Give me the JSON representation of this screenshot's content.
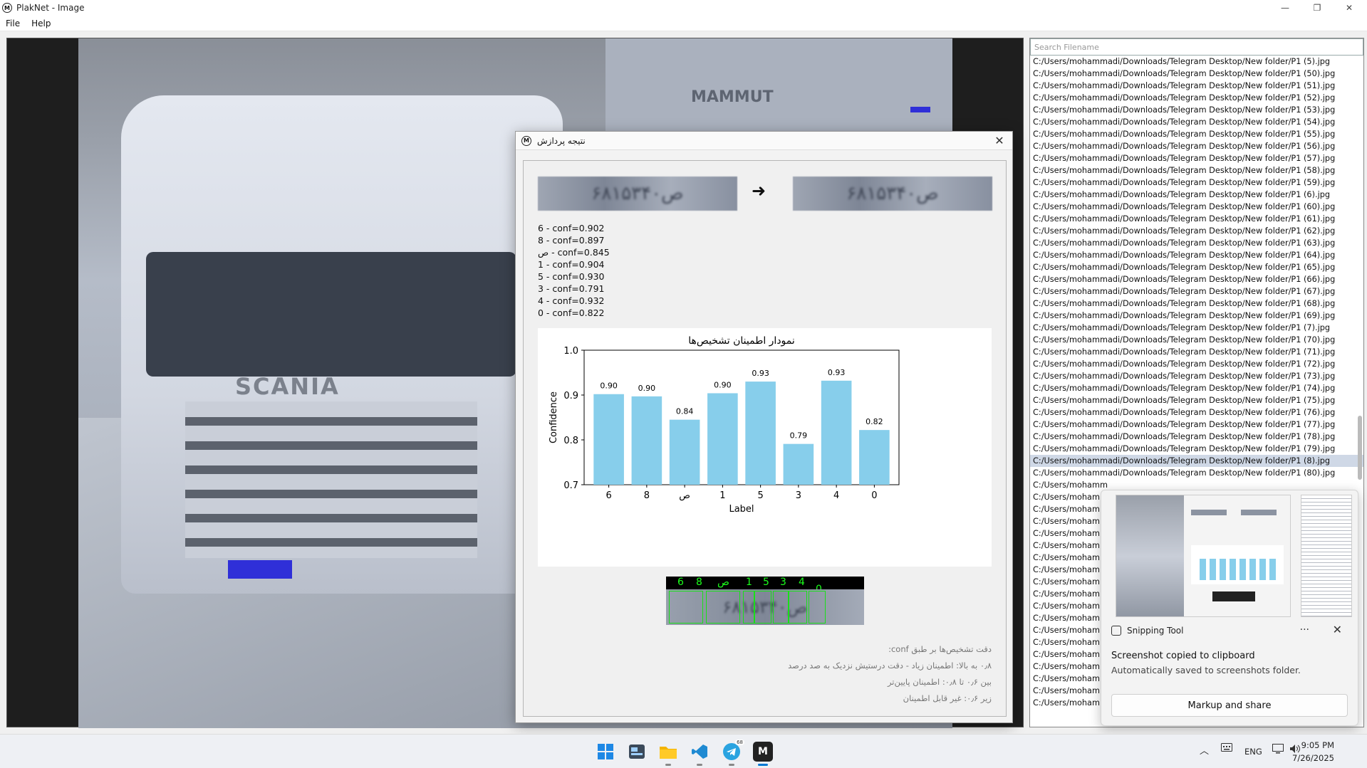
{
  "window": {
    "title": "PlakNet - Image",
    "logo_letter": "M",
    "minimize": "—",
    "maximize": "❐",
    "close": "✕"
  },
  "menu": [
    "File",
    "Help"
  ],
  "filelist": {
    "search_placeholder": "Search Filename",
    "items": [
      "C:/Users/mohammadi/Downloads/Telegram Desktop/New folder/P1 (5).jpg",
      "C:/Users/mohammadi/Downloads/Telegram Desktop/New folder/P1 (50).jpg",
      "C:/Users/mohammadi/Downloads/Telegram Desktop/New folder/P1 (51).jpg",
      "C:/Users/mohammadi/Downloads/Telegram Desktop/New folder/P1 (52).jpg",
      "C:/Users/mohammadi/Downloads/Telegram Desktop/New folder/P1 (53).jpg",
      "C:/Users/mohammadi/Downloads/Telegram Desktop/New folder/P1 (54).jpg",
      "C:/Users/mohammadi/Downloads/Telegram Desktop/New folder/P1 (55).jpg",
      "C:/Users/mohammadi/Downloads/Telegram Desktop/New folder/P1 (56).jpg",
      "C:/Users/mohammadi/Downloads/Telegram Desktop/New folder/P1 (57).jpg",
      "C:/Users/mohammadi/Downloads/Telegram Desktop/New folder/P1 (58).jpg",
      "C:/Users/mohammadi/Downloads/Telegram Desktop/New folder/P1 (59).jpg",
      "C:/Users/mohammadi/Downloads/Telegram Desktop/New folder/P1 (6).jpg",
      "C:/Users/mohammadi/Downloads/Telegram Desktop/New folder/P1 (60).jpg",
      "C:/Users/mohammadi/Downloads/Telegram Desktop/New folder/P1 (61).jpg",
      "C:/Users/mohammadi/Downloads/Telegram Desktop/New folder/P1 (62).jpg",
      "C:/Users/mohammadi/Downloads/Telegram Desktop/New folder/P1 (63).jpg",
      "C:/Users/mohammadi/Downloads/Telegram Desktop/New folder/P1 (64).jpg",
      "C:/Users/mohammadi/Downloads/Telegram Desktop/New folder/P1 (65).jpg",
      "C:/Users/mohammadi/Downloads/Telegram Desktop/New folder/P1 (66).jpg",
      "C:/Users/mohammadi/Downloads/Telegram Desktop/New folder/P1 (67).jpg",
      "C:/Users/mohammadi/Downloads/Telegram Desktop/New folder/P1 (68).jpg",
      "C:/Users/mohammadi/Downloads/Telegram Desktop/New folder/P1 (69).jpg",
      "C:/Users/mohammadi/Downloads/Telegram Desktop/New folder/P1 (7).jpg",
      "C:/Users/mohammadi/Downloads/Telegram Desktop/New folder/P1 (70).jpg",
      "C:/Users/mohammadi/Downloads/Telegram Desktop/New folder/P1 (71).jpg",
      "C:/Users/mohammadi/Downloads/Telegram Desktop/New folder/P1 (72).jpg",
      "C:/Users/mohammadi/Downloads/Telegram Desktop/New folder/P1 (73).jpg",
      "C:/Users/mohammadi/Downloads/Telegram Desktop/New folder/P1 (74).jpg",
      "C:/Users/mohammadi/Downloads/Telegram Desktop/New folder/P1 (75).jpg",
      "C:/Users/mohammadi/Downloads/Telegram Desktop/New folder/P1 (76).jpg",
      "C:/Users/mohammadi/Downloads/Telegram Desktop/New folder/P1 (77).jpg",
      "C:/Users/mohammadi/Downloads/Telegram Desktop/New folder/P1 (78).jpg",
      "C:/Users/mohammadi/Downloads/Telegram Desktop/New folder/P1 (79).jpg",
      "C:/Users/mohammadi/Downloads/Telegram Desktop/New folder/P1 (8).jpg",
      "C:/Users/mohammadi/Downloads/Telegram Desktop/New folder/P1 (80).jpg",
      "C:/Users/mohamm",
      "C:/Users/mohamm",
      "C:/Users/mohamm",
      "C:/Users/mohamm",
      "C:/Users/mohamm",
      "C:/Users/mohamm",
      "C:/Users/mohamm",
      "C:/Users/mohamm",
      "C:/Users/mohamm",
      "C:/Users/mohamm",
      "C:/Users/mohamm",
      "C:/Users/mohamm",
      "C:/Users/mohamm",
      "C:/Users/mohamm",
      "C:/Users/mohamm",
      "C:/Users/mohamm",
      "C:/Users/mohamm",
      "C:/Users/mohamm",
      "C:/Users/mohamm"
    ],
    "selected_index": 33
  },
  "photo": {
    "brand_text": "SCANIA",
    "trailer_text": "MAMMUT"
  },
  "dialog": {
    "title": "نتیجه پردازش",
    "close_label": "✕",
    "plate_before": "۶۸ص۱۵۳۴۰",
    "plate_after": "۶۸ص۱۵۳۴۰",
    "arrow": "➜",
    "conf_lines": [
      "6 - conf=0.902",
      "8 - conf=0.897",
      "ص - conf=0.845",
      "1 - conf=0.904",
      "5 - conf=0.930",
      "3 - conf=0.791",
      "4 - conf=0.932",
      "0 - conf=0.822"
    ],
    "seg_labels": [
      "6",
      "8",
      "ص",
      "1",
      "5",
      "3",
      "4",
      "0"
    ],
    "seg_plate_text": "۶۸ص۱۵۳۴۰",
    "notes": [
      "دقت تشخیص‌ها بر طبق conf:",
      "۰٫۸ به بالا: اطمینان زیاد - دقت درستیش نزدیک به صد درصد",
      "بین ۰٫۶ تا ۰٫۸: اطمینان پایین‌تر",
      "زیر ۰٫۶: غیر قابل اطمینان"
    ]
  },
  "chart_data": {
    "type": "bar",
    "title": "نمودار اطمینان تشخیص‌ها",
    "xlabel": "Label",
    "ylabel": "Confidence",
    "categories": [
      "6",
      "8",
      "ص",
      "1",
      "5",
      "3",
      "4",
      "0"
    ],
    "values": [
      0.902,
      0.897,
      0.845,
      0.904,
      0.93,
      0.791,
      0.932,
      0.822
    ],
    "value_labels": [
      "0.90",
      "0.90",
      "0.84",
      "0.90",
      "0.93",
      "0.79",
      "0.93",
      "0.82"
    ],
    "ylim": [
      0.7,
      1.0
    ],
    "yticks": [
      "0.7",
      "0.8",
      "0.9",
      "1.0"
    ],
    "bar_color": "#87ceeb",
    "grid": false
  },
  "toast": {
    "app_name": "Snipping Tool",
    "more": "···",
    "close": "✕",
    "message": "Screenshot copied to clipboard",
    "sub": "Automatically saved to screenshots folder.",
    "button": "Markup and share"
  },
  "taskbar": {
    "lang": "ENG",
    "time": "9:05 PM",
    "date": "7/26/2025",
    "telegram_badge": "68"
  }
}
